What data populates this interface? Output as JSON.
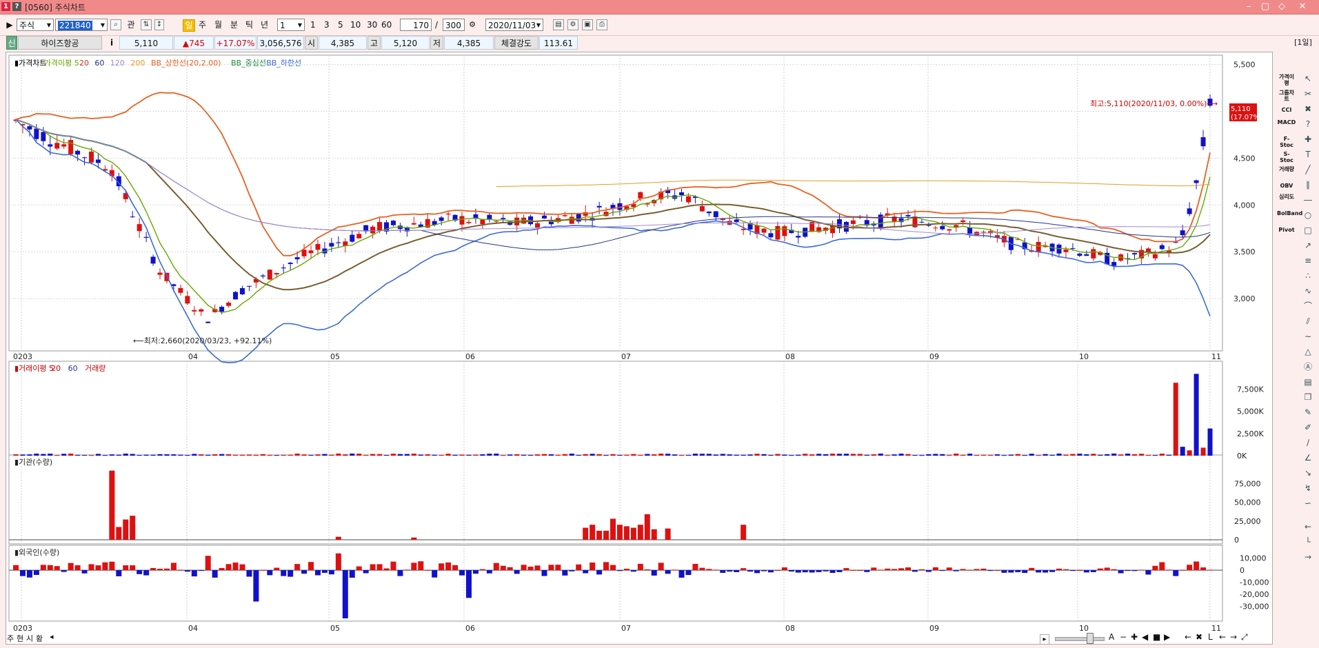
{
  "window": {
    "title": "[0560] 주식차트",
    "num_icon": "1",
    "help_icon": "?"
  },
  "toolbar": {
    "market": "주식",
    "code": "221840",
    "search_label": "관",
    "periods": [
      "일",
      "주",
      "월",
      "분",
      "틱",
      "년"
    ],
    "period_value": "1",
    "minute_options": [
      "1",
      "3",
      "5",
      "10",
      "30",
      "60"
    ],
    "count": "170",
    "slash": "/",
    "total": "300",
    "date": "2020/11/03"
  },
  "info": {
    "badge": "신",
    "name": "하이즈항공",
    "price": "5,110",
    "change": "▲745",
    "change_pct": "+17.07%",
    "volume": "3,056,576",
    "open_label": "시",
    "open": "4,385",
    "high_label": "고",
    "high": "5,120",
    "low_label": "저",
    "low": "4,385",
    "strength_label": "체결강도",
    "strength": "113.61",
    "period_tag": "[1일]"
  },
  "panels": {
    "price": {
      "legend": [
        {
          "text": "가격차트",
          "color": "#000000"
        },
        {
          "text": "가격이평 5",
          "color": "#66a800"
        },
        {
          "text": "20",
          "color": "#cc3322"
        },
        {
          "text": "60",
          "color": "#223388"
        },
        {
          "text": "120",
          "color": "#a28ad2"
        },
        {
          "text": "200",
          "color": "#e89a20"
        },
        {
          "text": "BB_상한선(20,2.00)",
          "color": "#e86020"
        },
        {
          "text": "BB_중심선",
          "color": "#1f8a3a"
        },
        {
          "text": "BB_하한선",
          "color": "#3a6ad8"
        }
      ],
      "yticks": [
        "5,500",
        "5,000",
        "4,500",
        "4,000",
        "3,500",
        "3,000"
      ],
      "max_label": "최고:5,110(2020/11/03, 0.00%)⟶",
      "min_label": "⟵최저:2,660(2020/03/23, +92.11%)",
      "last_price_tag": "5,110",
      "last_pct_tag": "(17.07%)"
    },
    "volume": {
      "legend": [
        {
          "text": "거래이평 5",
          "color": "#cc0000"
        },
        {
          "text": "20",
          "color": "#cc0000"
        },
        {
          "text": "60",
          "color": "#2233aa"
        },
        {
          "text": "거래량",
          "color": "#cc0000"
        }
      ],
      "yticks": [
        "7,500K",
        "5,000K",
        "2,500K",
        "0K"
      ]
    },
    "institution": {
      "legend": "기관(수량)",
      "yticks": [
        "75,000",
        "50,000",
        "25,000",
        "0"
      ]
    },
    "foreign": {
      "legend": "외국인(수량)",
      "yticks": [
        "10,000",
        "0",
        "-10,000",
        "-20,000",
        "-30,000"
      ]
    }
  },
  "xaxis": {
    "labels": [
      "02",
      "03",
      "04",
      "05",
      "06",
      "07",
      "08",
      "09",
      "10",
      "11"
    ]
  },
  "sidebar": {
    "labels": [
      "가격이평",
      "그룹차트",
      "CCI",
      "MACD",
      "F-Stoc",
      "S-Stoc",
      "거래량",
      "OBV",
      "심리도",
      "BolBand",
      "Pivot"
    ]
  },
  "bottom": {
    "tabs": [
      "주",
      "현",
      "시",
      "황"
    ]
  },
  "colors": {
    "up": "#dd1111",
    "down": "#1111cc",
    "titlebar": "#f08a8a",
    "frame_bg": "#fdeeee"
  },
  "chart_data": [
    {
      "type": "candlestick",
      "title": "가격차트",
      "x_range": [
        "2020/02",
        "2020/11/03"
      ],
      "ylim": [
        2500,
        5600
      ],
      "ohlc_anchors": [
        {
          "date": "2020/02",
          "close": 4900
        },
        {
          "date": "2020/03/23",
          "low": 2660
        },
        {
          "date": "2020/05",
          "close": 3900
        },
        {
          "date": "2020/06",
          "close": 4100
        },
        {
          "date": "2020/07",
          "close": 3750
        },
        {
          "date": "2020/08",
          "close": 3550
        },
        {
          "date": "2020/09",
          "close": 3450
        },
        {
          "date": "2020/10",
          "close": 3550
        },
        {
          "date": "2020/11/03",
          "open": 4385,
          "high": 5120,
          "low": 4385,
          "close": 5110
        }
      ],
      "max": {
        "value": 5110,
        "date": "2020/11/03"
      },
      "min": {
        "value": 2660,
        "date": "2020/03/23"
      }
    },
    {
      "type": "bar",
      "title": "거래량",
      "ylim": [
        0,
        10000000
      ],
      "series": [
        {
          "name": "거래량",
          "last_values": [
            8200000,
            1000000,
            9200000,
            900000,
            3056576
          ]
        }
      ]
    },
    {
      "type": "bar",
      "title": "기관(수량)",
      "ylim": [
        0,
        100000
      ],
      "notable": [
        {
          "date": "2020/03",
          "value": 92000
        }
      ]
    },
    {
      "type": "bar",
      "title": "외국인(수량)",
      "ylim": [
        -40000,
        15000
      ],
      "notable": [
        {
          "date": "2020/05",
          "value": -40000
        }
      ]
    }
  ]
}
